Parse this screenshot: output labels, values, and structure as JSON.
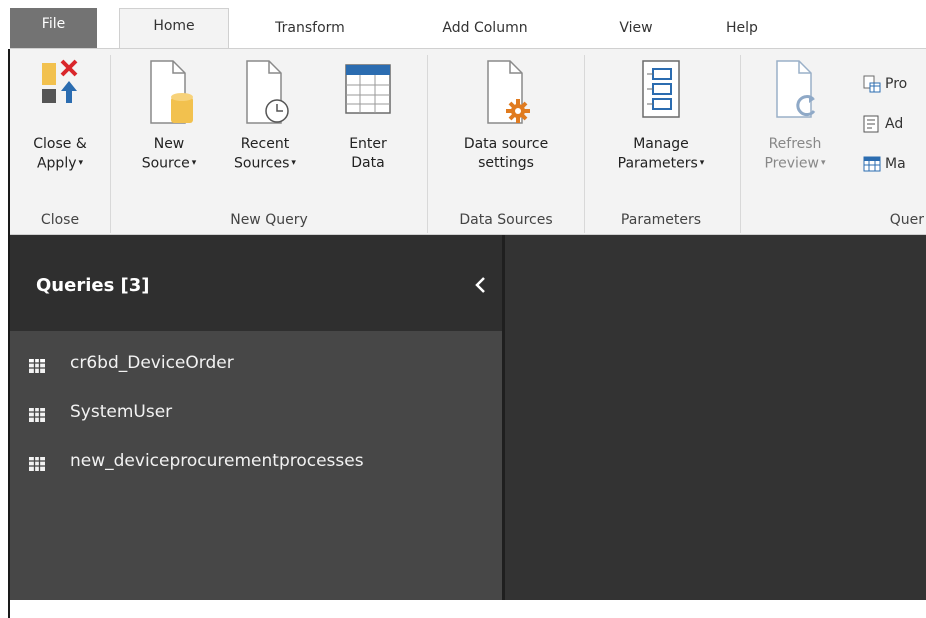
{
  "tabs": {
    "file": "File",
    "home": "Home",
    "transform": "Transform",
    "add_column": "Add Column",
    "view": "View",
    "help": "Help"
  },
  "ribbon": {
    "close_group": {
      "label": "Close",
      "close_apply_line1": "Close &",
      "close_apply_line2": "Apply"
    },
    "new_query_group": {
      "label": "New Query",
      "new_source_line1": "New",
      "new_source_line2": "Source",
      "recent_sources_line1": "Recent",
      "recent_sources_line2": "Sources",
      "enter_data_line1": "Enter",
      "enter_data_line2": "Data"
    },
    "data_sources_group": {
      "label": "Data Sources",
      "data_source_settings_line1": "Data source",
      "data_source_settings_line2": "settings"
    },
    "parameters_group": {
      "label": "Parameters",
      "manage_parameters_line1": "Manage",
      "manage_parameters_line2": "Parameters"
    },
    "query_group": {
      "label": "Quer",
      "refresh_preview_line1": "Refresh",
      "refresh_preview_line2": "Preview",
      "properties_label": "Pro",
      "advanced_editor_label": "Ad",
      "manage_label": "Ma"
    },
    "caret": "▾"
  },
  "queries_pane": {
    "title": "Queries [3]",
    "items": [
      {
        "label": "cr6bd_DeviceOrder",
        "icon": "table-icon"
      },
      {
        "label": "SystemUser",
        "icon": "table-icon"
      },
      {
        "label": "new_deviceprocurementprocesses",
        "icon": "table-icon"
      }
    ]
  },
  "colors": {
    "ribbon_bg": "#f3f3f3",
    "queries_header_bg": "#2f2f2f",
    "queries_list_bg": "#474747",
    "main_area_bg": "#333333",
    "accent_blue": "#2b6cb0",
    "accent_yellow": "#f2c14e"
  }
}
